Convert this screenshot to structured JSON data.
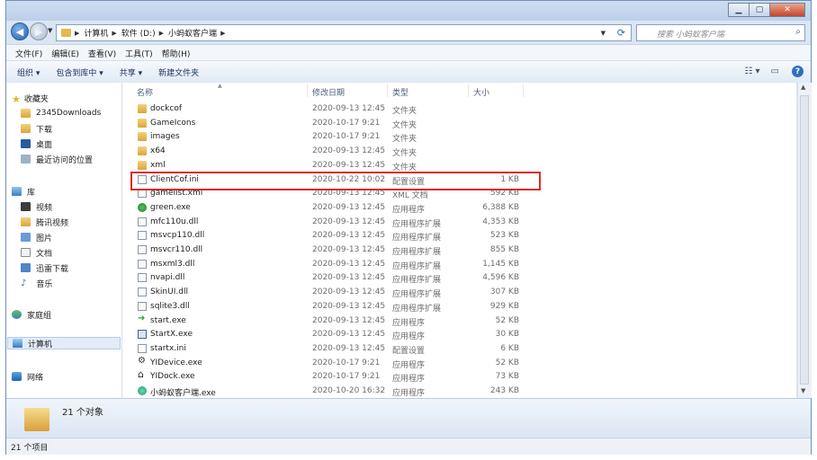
{
  "address": {
    "crumbs": [
      "计算机",
      "软件 (D:)",
      "小蚂蚁客户端"
    ]
  },
  "search": {
    "placeholder": "搜索 小蚂蚁客户端"
  },
  "menu": [
    "文件(F)",
    "编辑(E)",
    "查看(V)",
    "工具(T)",
    "帮助(H)"
  ],
  "toolbar": {
    "organize": "组织 ▾",
    "include_library": "包含到库中 ▾",
    "share": "共享 ▾",
    "new_folder": "新建文件夹"
  },
  "sidebar": {
    "favorites": "收藏夹",
    "fav_items": [
      "2345Downloads",
      "下载",
      "桌面",
      "最近访问的位置"
    ],
    "libraries": "库",
    "lib_items": [
      "视频",
      "腾讯视频",
      "图片",
      "文档",
      "迅雷下载",
      "音乐"
    ],
    "homegroup": "家庭组",
    "computer": "计算机",
    "network": "网络"
  },
  "columns": {
    "name": "名称",
    "date": "修改日期",
    "type": "类型",
    "size": "大小"
  },
  "files": [
    {
      "name": "dockcof",
      "date": "2020-09-13 12:45",
      "type": "文件夹",
      "size": "",
      "icon": "folder"
    },
    {
      "name": "GameIcons",
      "date": "2020-10-17 9:21",
      "type": "文件夹",
      "size": "",
      "icon": "folder"
    },
    {
      "name": "images",
      "date": "2020-10-17 9:21",
      "type": "文件夹",
      "size": "",
      "icon": "folder"
    },
    {
      "name": "x64",
      "date": "2020-09-13 12:45",
      "type": "文件夹",
      "size": "",
      "icon": "folder"
    },
    {
      "name": "xml",
      "date": "2020-09-13 12:45",
      "type": "文件夹",
      "size": "",
      "icon": "folder"
    },
    {
      "name": "ClientCof.ini",
      "date": "2020-10-22 10:02",
      "type": "配置设置",
      "size": "1 KB",
      "icon": "ini"
    },
    {
      "name": "gamelist.xml",
      "date": "2020-09-13 12:45",
      "type": "XML 文档",
      "size": "592 KB",
      "icon": "xml"
    },
    {
      "name": "green.exe",
      "date": "2020-09-13 12:45",
      "type": "应用程序",
      "size": "6,388 KB",
      "icon": "exe-green"
    },
    {
      "name": "mfc110u.dll",
      "date": "2020-09-13 12:45",
      "type": "应用程序扩展",
      "size": "4,353 KB",
      "icon": "dll"
    },
    {
      "name": "msvcp110.dll",
      "date": "2020-09-13 12:45",
      "type": "应用程序扩展",
      "size": "523 KB",
      "icon": "dll"
    },
    {
      "name": "msvcr110.dll",
      "date": "2020-09-13 12:45",
      "type": "应用程序扩展",
      "size": "855 KB",
      "icon": "dll"
    },
    {
      "name": "msxml3.dll",
      "date": "2020-09-13 12:45",
      "type": "应用程序扩展",
      "size": "1,145 KB",
      "icon": "dll"
    },
    {
      "name": "nvapi.dll",
      "date": "2020-09-13 12:45",
      "type": "应用程序扩展",
      "size": "4,596 KB",
      "icon": "dll"
    },
    {
      "name": "SkinUI.dll",
      "date": "2020-09-13 12:45",
      "type": "应用程序扩展",
      "size": "307 KB",
      "icon": "dll"
    },
    {
      "name": "sqlite3.dll",
      "date": "2020-09-13 12:45",
      "type": "应用程序扩展",
      "size": "929 KB",
      "icon": "dll"
    },
    {
      "name": "start.exe",
      "date": "2020-09-13 12:45",
      "type": "应用程序",
      "size": "52 KB",
      "icon": "exe-arrow"
    },
    {
      "name": "StartX.exe",
      "date": "2020-09-13 12:45",
      "type": "应用程序",
      "size": "30 KB",
      "icon": "exe-window"
    },
    {
      "name": "startx.ini",
      "date": "2020-09-13 12:45",
      "type": "配置设置",
      "size": "6 KB",
      "icon": "ini"
    },
    {
      "name": "YIDevice.exe",
      "date": "2020-10-17 9:21",
      "type": "应用程序",
      "size": "52 KB",
      "icon": "exe-gear"
    },
    {
      "name": "YIDock.exe",
      "date": "2020-10-17 9:21",
      "type": "应用程序",
      "size": "73 KB",
      "icon": "exe-home"
    },
    {
      "name": "小蚂蚁客户端.exe",
      "date": "2020-10-20 16:32",
      "type": "应用程序",
      "size": "243 KB",
      "icon": "exe-ant"
    }
  ],
  "details": {
    "count": "21 个对象"
  },
  "status": {
    "items": "21 个项目"
  },
  "colors": {
    "highlight": "#e02a2a"
  }
}
